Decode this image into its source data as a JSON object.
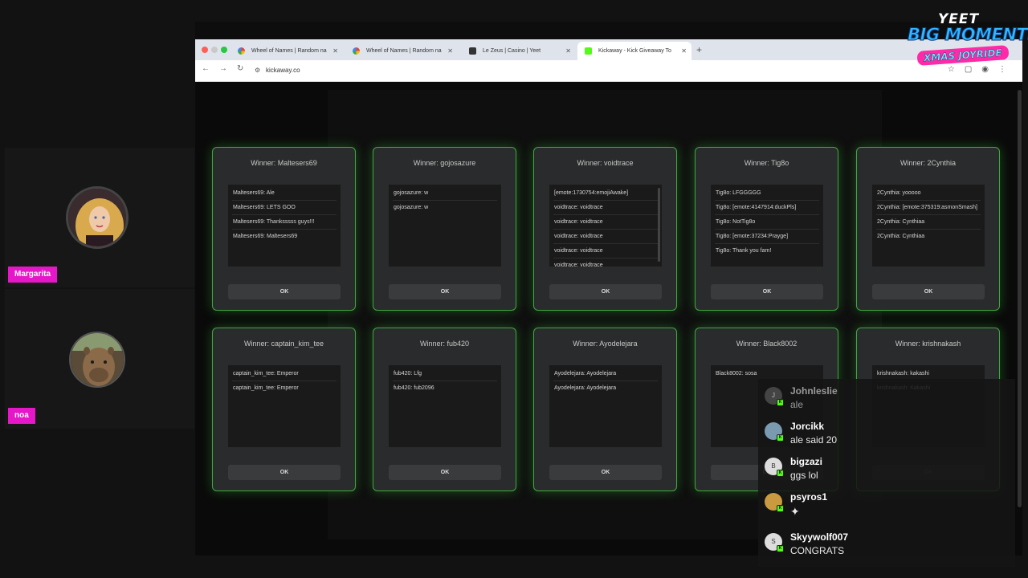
{
  "participants": [
    {
      "name": "Margarita"
    },
    {
      "name": "noa"
    }
  ],
  "browser": {
    "tabs": [
      {
        "label": "Wheel of Names | Random na",
        "active": false
      },
      {
        "label": "Wheel of Names | Random na",
        "active": false
      },
      {
        "label": "Le Zeus | Casino | Yeet",
        "active": false
      },
      {
        "label": "Kickaway - Kick Giveaway To",
        "active": true
      }
    ],
    "new_tab": "+",
    "url": "kickaway.co"
  },
  "modals": [
    {
      "title": "Winner: Maltesers69",
      "ok": "OK",
      "messages": [
        "Maltesers69: Ale",
        "Maltesers69: LETS GOO",
        "Maltesers69: Thanksssss guys!!!",
        "Maltesers69: Maltesers69"
      ]
    },
    {
      "title": "Winner: gojosazure",
      "ok": "OK",
      "messages": [
        "gojosazure: w",
        "gojosazure: w"
      ]
    },
    {
      "title": "Winner: voidtrace",
      "ok": "OK",
      "messages": [
        "[emote:1730754:emojiAwake]",
        "voidtrace: voidtrace",
        "voidtrace: voidtrace",
        "voidtrace: voidtrace",
        "voidtrace: voidtrace",
        "voidtrace: voidtrace"
      ]
    },
    {
      "title": "Winner: Tig8o",
      "ok": "OK",
      "messages": [
        "Tig8o: LFGGGGG",
        "Tig8o: [emote:4147914:duckPls]",
        "Tig8o: NotTig8o",
        "Tig8o: [emote:37234:Prayge]",
        "Tig8o: Thank you fam!"
      ]
    },
    {
      "title": "Winner: 2Cynthia",
      "ok": "OK",
      "messages": [
        "2Cynthia: yooooo",
        "2Cynthia: [emote:375319:asmonSmash]",
        "2Cynthia: Cynthiaa",
        "2Cynthia: Cynthiaa"
      ]
    },
    {
      "title": "Winner: captain_kim_tee",
      "ok": "OK",
      "messages": [
        "captain_kim_tee: Emperor",
        "captain_kim_tee: Emperor"
      ]
    },
    {
      "title": "Winner: fub420",
      "ok": "OK",
      "messages": [
        "fub420: Lfg",
        "fub420: fub2096"
      ]
    },
    {
      "title": "Winner: Ayodelejara",
      "ok": "OK",
      "messages": [
        "Ayodelejara: Ayodelejara",
        "Ayodelejara: Ayodelejara"
      ]
    },
    {
      "title": "Winner: Black8002",
      "ok": "OK",
      "messages": [
        "Black8002: sosa"
      ]
    },
    {
      "title": "Winner: krishnakash",
      "ok": "OK",
      "messages": [
        "krishnakash: kakashi",
        "krishnakash: Kakashi"
      ]
    }
  ],
  "chat": [
    {
      "user": "Johnleslie",
      "text": "ale",
      "initial": "J"
    },
    {
      "user": "Jorcikk",
      "text": "ale said 20",
      "initial": ""
    },
    {
      "user": "bigzazi",
      "text": "ggs lol",
      "initial": "B"
    },
    {
      "user": "psyros1",
      "text": "",
      "initial": ""
    },
    {
      "user": "Skyywolf007",
      "text": "CONGRATS",
      "initial": "S"
    }
  ],
  "logo": {
    "line1": "YEET",
    "line2": "BIG MOMENTS",
    "line3": "XMAS JOYRIDE"
  },
  "colors": {
    "accent_green": "#3fa63f",
    "name_tag": "#e617c8",
    "kick_green": "#53fc18"
  }
}
